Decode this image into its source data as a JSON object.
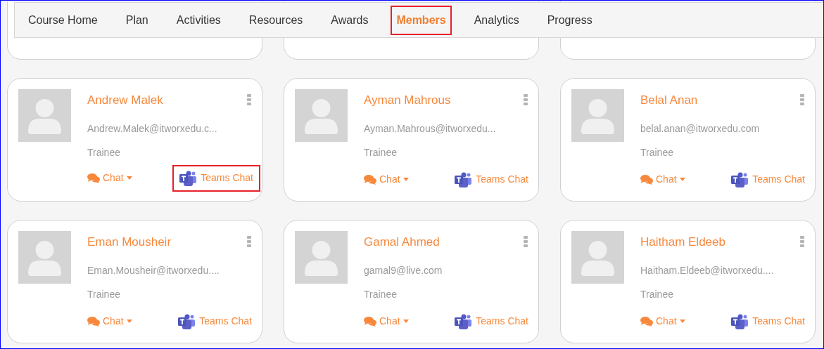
{
  "tabs": [
    {
      "label": "Course Home",
      "selected": false,
      "highlighted": false
    },
    {
      "label": "Plan",
      "selected": false,
      "highlighted": false
    },
    {
      "label": "Activities",
      "selected": false,
      "highlighted": false
    },
    {
      "label": "Resources",
      "selected": false,
      "highlighted": false
    },
    {
      "label": "Awards",
      "selected": false,
      "highlighted": false
    },
    {
      "label": "Members",
      "selected": true,
      "highlighted": true
    },
    {
      "label": "Analytics",
      "selected": false,
      "highlighted": false
    },
    {
      "label": "Progress",
      "selected": false,
      "highlighted": false
    }
  ],
  "members": [
    {
      "name": "Andrew Malek",
      "email": "Andrew.Malek@itworxedu.c...",
      "role": "Trainee",
      "chat": "Chat",
      "teams_chat": "Teams Chat",
      "teams_highlighted": true
    },
    {
      "name": "Ayman Mahrous",
      "email": "Ayman.Mahrous@itworxedu...",
      "role": "Trainee",
      "chat": "Chat",
      "teams_chat": "Teams Chat",
      "teams_highlighted": false
    },
    {
      "name": "Belal Anan",
      "email": "belal.anan@itworxedu.com",
      "role": "Trainee",
      "chat": "Chat",
      "teams_chat": "Teams Chat",
      "teams_highlighted": false
    },
    {
      "name": "Eman Mousheir",
      "email": "Eman.Mousheir@itworxedu....",
      "role": "Trainee",
      "chat": "Chat",
      "teams_chat": "Teams Chat",
      "teams_highlighted": false
    },
    {
      "name": "Gamal Ahmed",
      "email": "gamal9@live.com",
      "role": "Trainee",
      "chat": "Chat",
      "teams_chat": "Teams Chat",
      "teams_highlighted": false
    },
    {
      "name": "Haitham Eldeeb",
      "email": "Haitham.Eldeeb@itworxedu....",
      "role": "Trainee",
      "chat": "Chat",
      "teams_chat": "Teams Chat",
      "teams_highlighted": false
    }
  ]
}
